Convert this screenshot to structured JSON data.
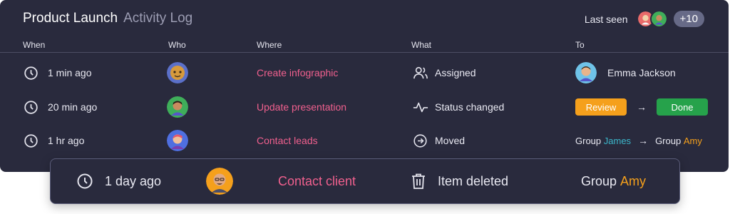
{
  "header": {
    "title": "Product Launch",
    "subtitle": "Activity Log",
    "last_seen_label": "Last seen",
    "more_count": "+10"
  },
  "columns": [
    "When",
    "Who",
    "Where",
    "What",
    "To"
  ],
  "rows": [
    {
      "when": "1 min ago",
      "where": "Create infographic",
      "what": "Assigned",
      "what_icon": "assign-user-icon",
      "to_name": "Emma Jackson"
    },
    {
      "when": "20 min ago",
      "where": "Update presentation",
      "what": "Status changed",
      "what_icon": "pulse-icon",
      "to_from": "Review",
      "to_to": "Done"
    },
    {
      "when": "1 hr ago",
      "where": "Contact leads",
      "what": "Moved",
      "what_icon": "arrow-circle-icon",
      "group_label": "Group",
      "from_group": "James",
      "to_group": "Amy"
    }
  ],
  "highlight": {
    "when": "1 day ago",
    "where": "Contact client",
    "what": "Item deleted",
    "what_icon": "trash-icon",
    "group_label": "Group",
    "group": "Amy"
  },
  "colors": {
    "panel": "#292a3d",
    "link": "#f0608e",
    "review": "#f5a01c",
    "done": "#26a24b",
    "james": "#3cb8cc",
    "amy": "#f5a01c"
  }
}
